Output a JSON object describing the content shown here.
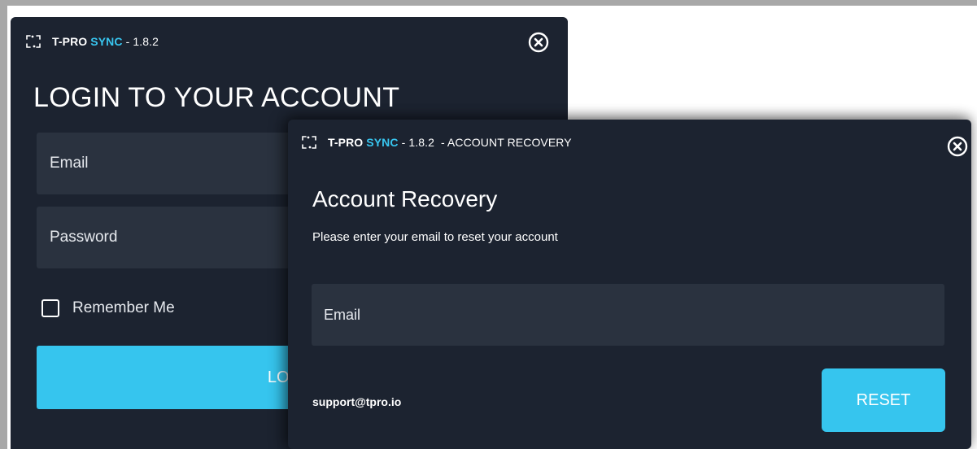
{
  "login_window": {
    "app_name": "T-PRO",
    "app_name_accent": "SYNC",
    "version": " - 1.8.2",
    "heading": "LOGIN TO YOUR ACCOUNT",
    "email_placeholder": "Email",
    "password_placeholder": "Password",
    "remember_label": "Remember Me",
    "login_button": "LOGIN"
  },
  "recovery_window": {
    "app_name": "T-PRO",
    "app_name_accent": "SYNC",
    "version": " - 1.8.2",
    "title_suffix": "  - ACCOUNT RECOVERY",
    "heading": "Account Recovery",
    "subtext": "Please enter your email to reset your account",
    "email_placeholder": "Email",
    "support_email": "support@tpro.io",
    "reset_button": "RESET"
  },
  "icons": {
    "app": "app-logo-icon",
    "close": "close-circle-icon",
    "checkbox": "checkbox-unchecked"
  },
  "colors": {
    "window_bg": "#1c2330",
    "input_bg": "#2a323f",
    "accent": "#38c6f0",
    "button": "#36c5ee"
  }
}
